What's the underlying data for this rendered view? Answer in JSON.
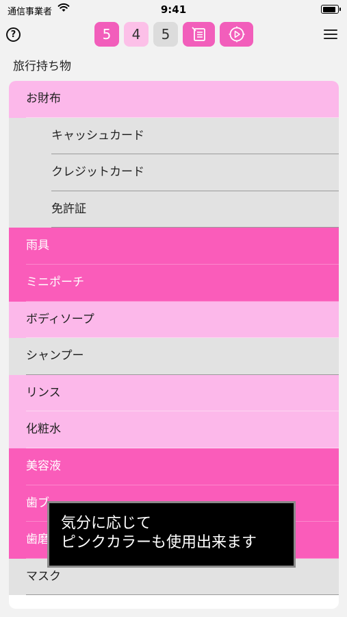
{
  "status_bar": {
    "carrier": "通信事業者",
    "time": "9:41",
    "battery_level": 0.92
  },
  "toolbar": {
    "help_label": "?",
    "count_buttons": [
      "5",
      "4",
      "5"
    ],
    "icons": [
      "list-icon",
      "play-circle-icon",
      "menu-icon"
    ]
  },
  "list_title": "旅行持ち物",
  "items": [
    {
      "label": "お財布",
      "style": "pink-light",
      "child": false
    },
    {
      "label": "キャッシュカード",
      "style": "gray",
      "child": true
    },
    {
      "label": "クレジットカード",
      "style": "gray",
      "child": true
    },
    {
      "label": "免許証",
      "style": "gray",
      "child": true
    },
    {
      "label": "雨具",
      "style": "pink-hot",
      "child": false
    },
    {
      "label": "ミニポーチ",
      "style": "pink-hot",
      "child": false
    },
    {
      "label": "ボディソープ",
      "style": "pink-light",
      "child": false
    },
    {
      "label": "シャンプー",
      "style": "gray",
      "child": false
    },
    {
      "label": "リンス",
      "style": "pink-light",
      "child": false
    },
    {
      "label": "化粧水",
      "style": "pink-light",
      "child": false
    },
    {
      "label": "美容液",
      "style": "pink-hot",
      "child": false
    },
    {
      "label": "歯ブ",
      "style": "pink-hot",
      "child": false
    },
    {
      "label": "歯磨",
      "style": "pink-hot",
      "child": false
    },
    {
      "label": "マスク",
      "style": "gray",
      "child": false
    }
  ],
  "colors": {
    "pink_light": "#fcb8ea",
    "pink_hot": "#fa5cba",
    "gray": "#e2e2e2"
  },
  "toast": {
    "line1": "気分に応じて",
    "line2": "ピンクカラーも使用出来ます"
  }
}
